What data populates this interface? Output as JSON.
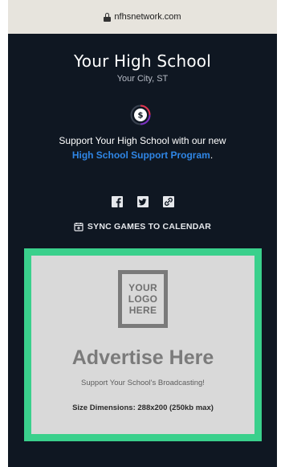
{
  "browser": {
    "url": "nfhsnetwork.com"
  },
  "school": {
    "name": "Your High School",
    "location": "Your City, ST"
  },
  "support": {
    "text": "Support Your High School with our new",
    "link_label": "High School Support Program",
    "link_suffix": "."
  },
  "social": {
    "icons": [
      "facebook-icon",
      "twitter-icon",
      "link-icon"
    ]
  },
  "sync": {
    "label": "SYNC GAMES TO CALENDAR"
  },
  "ad": {
    "logo_lines": [
      "YOUR",
      "LOGO",
      "HERE"
    ],
    "title": "Advertise Here",
    "subtitle": "Support Your School's Broadcasting!",
    "size_note": "Size Dimensions: 288x200 (250kb max)"
  },
  "colors": {
    "background": "#0f1722",
    "link": "#2f86e6",
    "ad_border": "#3ad08c",
    "ad_fill": "#d9d9d9"
  }
}
